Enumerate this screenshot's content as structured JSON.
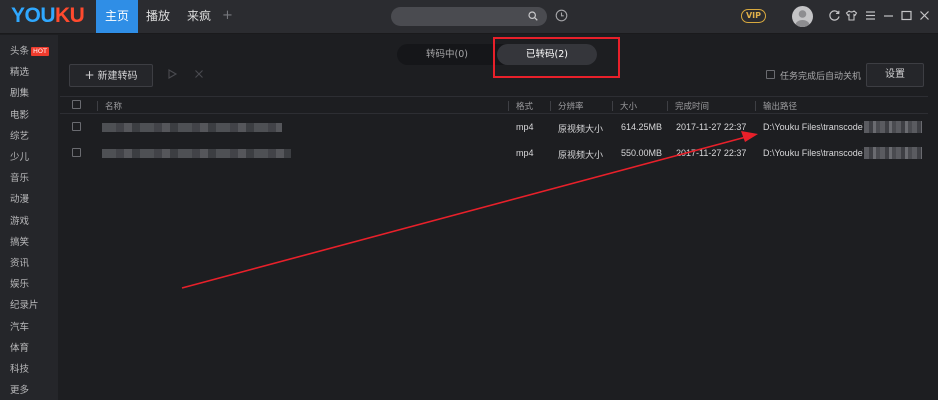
{
  "app": {
    "logo_part1": "YOU",
    "logo_part2": "KU"
  },
  "nav_tabs": [
    {
      "label": "主页"
    },
    {
      "label": "播放"
    },
    {
      "label": "来疯"
    }
  ],
  "nav_plus": "+",
  "vip_badge": "VIP",
  "sidebar": {
    "hot_badge": "HOT",
    "items": [
      {
        "label": "头条"
      },
      {
        "label": "精选"
      },
      {
        "label": "剧集"
      },
      {
        "label": "电影"
      },
      {
        "label": "综艺"
      },
      {
        "label": "少儿"
      },
      {
        "label": "音乐"
      },
      {
        "label": "动漫"
      },
      {
        "label": "游戏"
      },
      {
        "label": "搞笑"
      },
      {
        "label": "资讯"
      },
      {
        "label": "娱乐"
      },
      {
        "label": "纪录片"
      },
      {
        "label": "汽车"
      },
      {
        "label": "体育"
      },
      {
        "label": "科技"
      },
      {
        "label": "更多"
      }
    ]
  },
  "segments": [
    {
      "label": "转码中(0)"
    },
    {
      "label": "已转码(2)"
    }
  ],
  "toolbar": {
    "new_button": "新建转码",
    "auto_shutdown_label": "任务完成后自动关机",
    "settings_button": "设置"
  },
  "table": {
    "columns": [
      "名称",
      "格式",
      "分辨率",
      "大小",
      "完成时间",
      "输出路径"
    ],
    "rows": [
      {
        "format": "mp4",
        "resolution": "原视频大小",
        "size": "614.25MB",
        "time": "2017-11-27 22:37",
        "path": "D:\\Youku Files\\transcode\\"
      },
      {
        "format": "mp4",
        "resolution": "原视频大小",
        "size": "550.00MB",
        "time": "2017-11-27 22:37",
        "path": "D:\\Youku Files\\transcode\\"
      }
    ]
  },
  "colors": {
    "accent": "#2f8ee6",
    "annotation_red": "#e8202a",
    "background": "#1d1e21",
    "sidebar": "#25262a"
  }
}
